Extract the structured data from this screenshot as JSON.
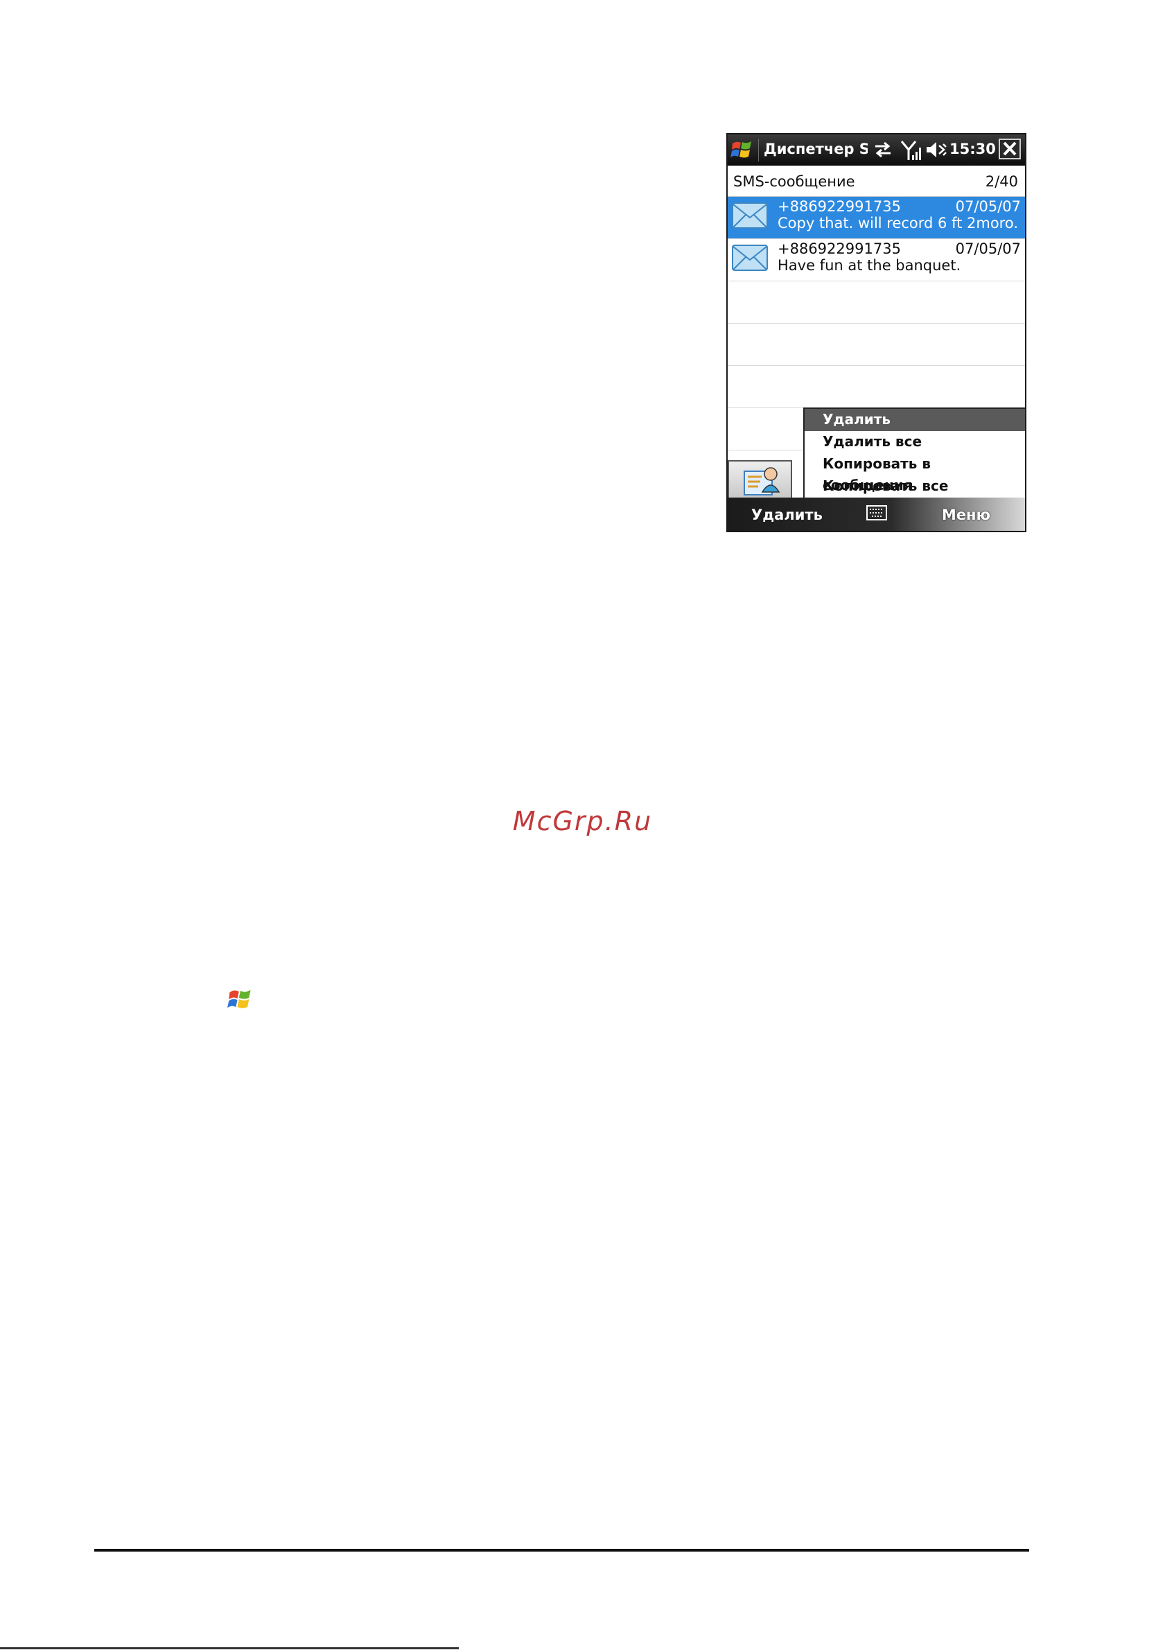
{
  "phone": {
    "titlebar": {
      "title": "Диспетчер SIM",
      "time": "15:30",
      "icons": [
        "windows-start-icon",
        "connectivity-icon",
        "signal-icon",
        "volume-muted-icon",
        "close-icon"
      ]
    },
    "list_header": {
      "title": "SMS-сообщение",
      "count": "2/40"
    },
    "messages": [
      {
        "number": "+886922991735",
        "date": "07/05/07",
        "text": "Copy that. will record 6 ft 2moro.",
        "selected": true
      },
      {
        "number": "+886922991735",
        "date": "07/05/07",
        "text": "Have fun at the banquet.",
        "selected": false
      }
    ],
    "context_menu": {
      "items": [
        "Удалить",
        "Удалить все",
        "Копировать в сообщения",
        "Копировать все"
      ],
      "highlighted_index": 0
    },
    "softkeys": {
      "left": "Удалить",
      "right": "Меню",
      "center_icon": "keyboard-icon"
    }
  },
  "watermark": "McGrp.Ru",
  "colors": {
    "selection": "#2d89e0",
    "watermark": "#c0393b"
  }
}
